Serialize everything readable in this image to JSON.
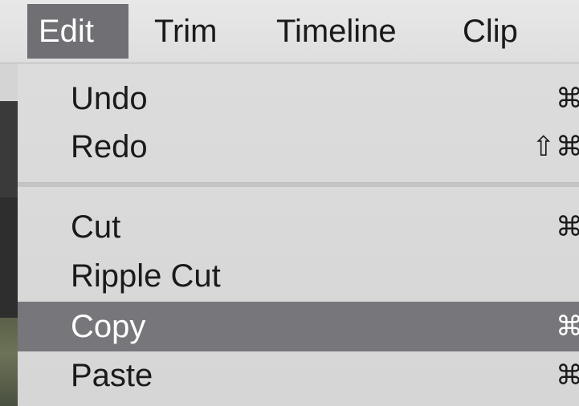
{
  "menubar": {
    "items": [
      {
        "label": "Edit",
        "active": true
      },
      {
        "label": "Trim",
        "active": false
      },
      {
        "label": "Timeline",
        "active": false
      },
      {
        "label": "Clip",
        "active": false
      }
    ]
  },
  "edit_menu": {
    "items": [
      {
        "label": "Undo",
        "shortcut": "⌘"
      },
      {
        "label": "Redo",
        "shortcut": "⇧⌘"
      },
      {
        "label": "Cut",
        "shortcut": "⌘"
      },
      {
        "label": "Ripple Cut",
        "shortcut": ""
      },
      {
        "label": "Copy",
        "shortcut": "⌘",
        "highlighted": true
      },
      {
        "label": "Paste",
        "shortcut": "⌘"
      }
    ]
  },
  "colors": {
    "menubar_bg": "#e3e3e3",
    "menu_bg": "#d9d9d9",
    "highlight": "#76767b",
    "text": "#1a1a1a",
    "highlight_text": "#ffffff"
  }
}
